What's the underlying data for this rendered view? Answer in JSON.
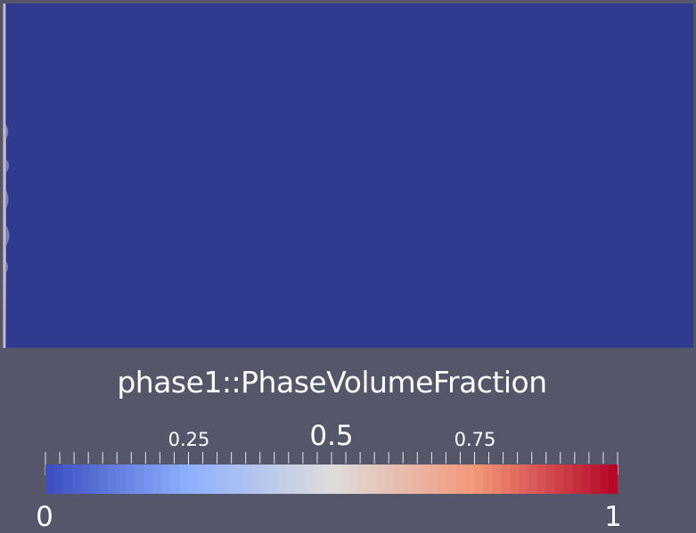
{
  "colorbar": {
    "title": "phase1::PhaseVolumeFraction",
    "range_min": "0",
    "range_max": "1",
    "labels": [
      "0.25",
      "0.5",
      "0.75"
    ],
    "colormap": [
      "#3b4cc0",
      "#8db0fe",
      "#dddddd",
      "#f4987a",
      "#b40426"
    ]
  },
  "colors": {
    "background": "#545669",
    "field_fill": "#2e3b8e",
    "interface_edge": "#b40426"
  }
}
